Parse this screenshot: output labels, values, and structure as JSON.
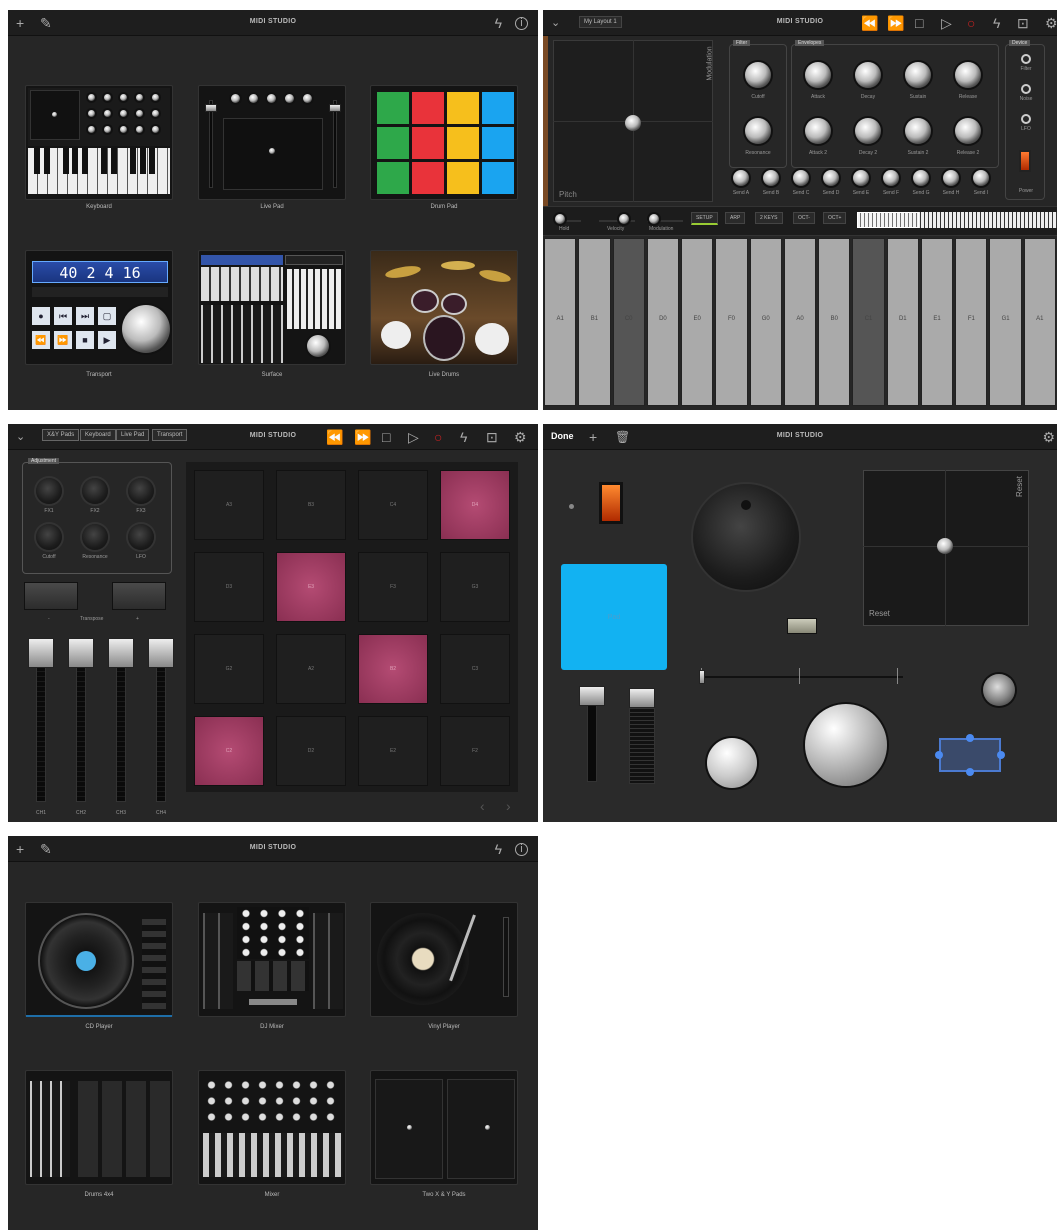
{
  "p1": {
    "title": "MIDI STUDIO",
    "tiles": [
      {
        "label": "Keyboard"
      },
      {
        "label": "Live Pad"
      },
      {
        "label": "Drum Pad"
      },
      {
        "label": "Transport"
      },
      {
        "label": "Surface"
      },
      {
        "label": "Live Drums"
      }
    ],
    "lcd": "40 2 4 16"
  },
  "p2": {
    "title": "MIDI STUDIO",
    "layout": "My Layout 1",
    "modulation": "Modulation",
    "pitch": "Pitch",
    "sections": {
      "filter": "Filter",
      "envelopes": "Envelopes",
      "device": "Device"
    },
    "filter_knobs": [
      "Cutoff",
      "Resonance"
    ],
    "env_knobs": [
      "Attack",
      "Decay",
      "Sustain",
      "Release",
      "Attack 2",
      "Decay 2",
      "Sustain 2",
      "Release 2"
    ],
    "sends": [
      "Send A",
      "Send B",
      "Send C",
      "Send D",
      "Send E",
      "Send F",
      "Send G",
      "Send H",
      "Send I"
    ],
    "device_items": [
      "Filter",
      "Noise",
      "LFO",
      "Power"
    ],
    "strip": {
      "hold": "Hold",
      "velocity": "Velocity",
      "modulation": "Modulation",
      "setup": "SETUP",
      "arp": "ARP",
      "keys": "2 KEYS",
      "oct_down": "OCT-",
      "oct_up": "OCT+"
    },
    "keys": [
      "A1",
      "B1",
      "C0",
      "D0",
      "E0",
      "F0",
      "G0",
      "A0",
      "B0",
      "C1",
      "D1",
      "E1",
      "F1",
      "G1",
      "A1"
    ]
  },
  "p3": {
    "title": "MIDI STUDIO",
    "tabs": [
      "X&Y Pads",
      "Keyboard",
      "Live Pad",
      "Transport"
    ],
    "adjustment": "Adjustment",
    "knobs": [
      "FX1",
      "FX2",
      "FX3",
      "Cutoff",
      "Resonance",
      "LFO"
    ],
    "transpose": "Transpose",
    "minus": "-",
    "plus": "+",
    "channels": [
      "CH1",
      "CH2",
      "CH3",
      "CH4"
    ],
    "pads": [
      {
        "n": "A3",
        "on": false
      },
      {
        "n": "B3",
        "on": false
      },
      {
        "n": "C4",
        "on": false
      },
      {
        "n": "D4",
        "on": true
      },
      {
        "n": "D3",
        "on": false
      },
      {
        "n": "E3",
        "on": true
      },
      {
        "n": "F3",
        "on": false
      },
      {
        "n": "G3",
        "on": false
      },
      {
        "n": "G2",
        "on": false
      },
      {
        "n": "A2",
        "on": false
      },
      {
        "n": "B2",
        "on": true
      },
      {
        "n": "C3",
        "on": false
      },
      {
        "n": "C2",
        "on": true
      },
      {
        "n": "D2",
        "on": false
      },
      {
        "n": "E2",
        "on": false
      },
      {
        "n": "F2",
        "on": false
      }
    ]
  },
  "p4": {
    "title": "MIDI STUDIO",
    "done": "Done",
    "pad_label": "Pad",
    "reset_h": "Reset",
    "reset_v": "Reset"
  },
  "p5": {
    "title": "MIDI STUDIO",
    "tiles": [
      {
        "label": "CD Player"
      },
      {
        "label": "DJ Mixer"
      },
      {
        "label": "Vinyl Player"
      },
      {
        "label": "Drums 4x4"
      },
      {
        "label": "Mixer"
      },
      {
        "label": "Two X & Y Pads"
      }
    ]
  }
}
